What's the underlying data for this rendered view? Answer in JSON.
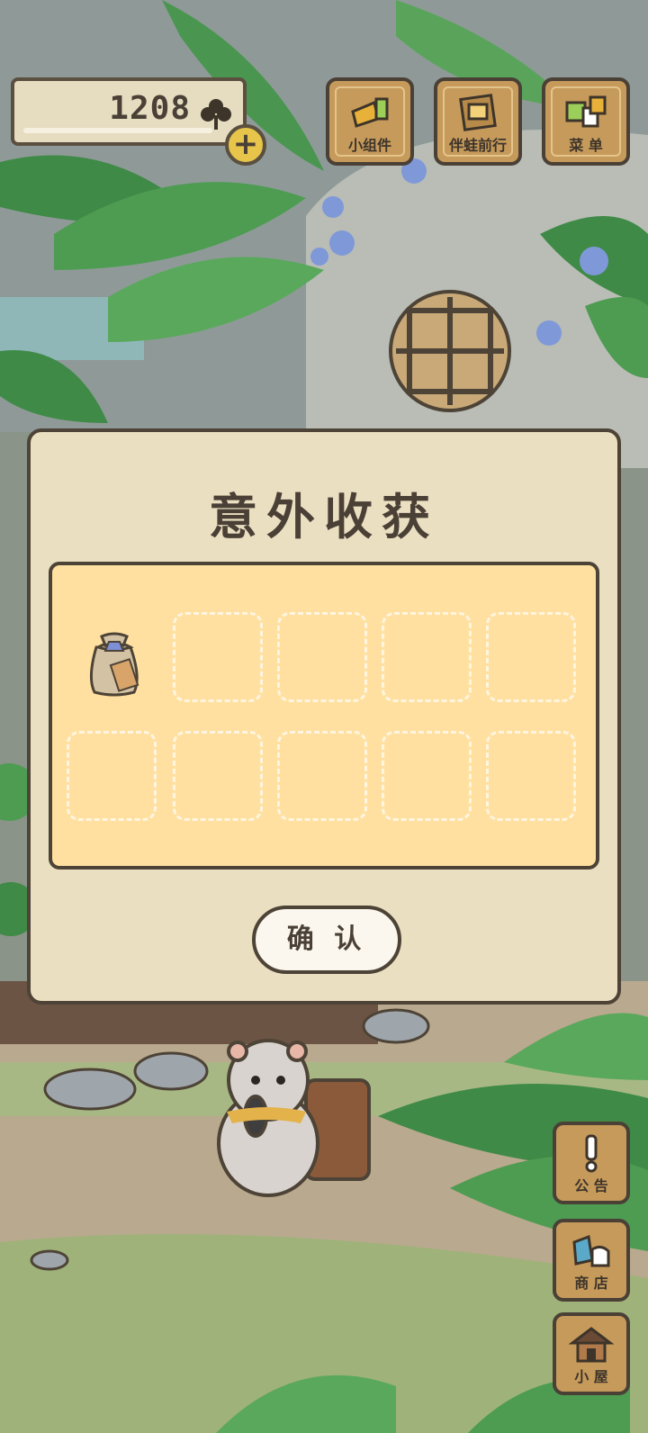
{
  "clovers": {
    "count": "1208"
  },
  "top_menu": [
    {
      "label": "小组件",
      "icon": "widget-icon"
    },
    {
      "label": "伴蛙前行",
      "icon": "journal-icon"
    },
    {
      "label": "菜 单",
      "icon": "menu-icon"
    }
  ],
  "side_menu": [
    {
      "label": "公 告",
      "icon": "exclamation-icon"
    },
    {
      "label": "商 店",
      "icon": "shop-bags-icon"
    },
    {
      "label": "小 屋",
      "icon": "house-icon"
    }
  ],
  "dialog": {
    "title": "意外收获",
    "slots_total": 10,
    "items": [
      {
        "slot": 1,
        "icon": "lucky-bag-icon"
      }
    ],
    "confirm_label": "确 认"
  },
  "colors": {
    "panel_bg": "#ebdfc2",
    "slot_area": "#ffe0a0",
    "wood_button": "#c69a5b",
    "outline": "#4d4336"
  }
}
